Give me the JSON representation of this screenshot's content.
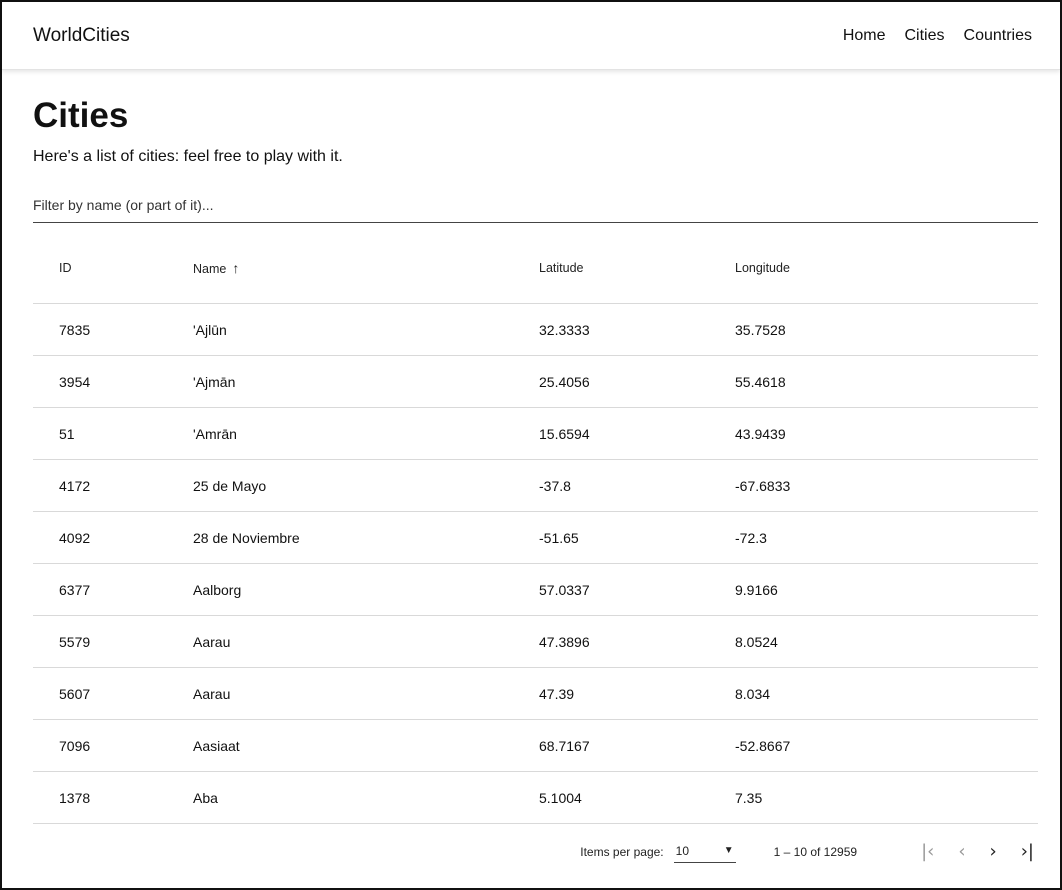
{
  "header": {
    "brand": "WorldCities",
    "nav": [
      "Home",
      "Cities",
      "Countries"
    ]
  },
  "page": {
    "title": "Cities",
    "subtitle": "Here's a list of cities: feel free to play with it."
  },
  "filter": {
    "placeholder": "Filter by name (or part of it)..."
  },
  "table": {
    "columns": {
      "id": "ID",
      "name": "Name",
      "lat": "Latitude",
      "lon": "Longitude"
    },
    "sort_icon": "arrow-up-icon",
    "rows": [
      {
        "id": "7835",
        "name": "'Ajlūn",
        "lat": "32.3333",
        "lon": "35.7528"
      },
      {
        "id": "3954",
        "name": "'Ajmān",
        "lat": "25.4056",
        "lon": "55.4618"
      },
      {
        "id": "51",
        "name": "'Amrān",
        "lat": "15.6594",
        "lon": "43.9439"
      },
      {
        "id": "4172",
        "name": "25 de Mayo",
        "lat": "-37.8",
        "lon": "-67.6833"
      },
      {
        "id": "4092",
        "name": "28 de Noviembre",
        "lat": "-51.65",
        "lon": "-72.3"
      },
      {
        "id": "6377",
        "name": "Aalborg",
        "lat": "57.0337",
        "lon": "9.9166"
      },
      {
        "id": "5579",
        "name": "Aarau",
        "lat": "47.3896",
        "lon": "8.0524"
      },
      {
        "id": "5607",
        "name": "Aarau",
        "lat": "47.39",
        "lon": "8.034"
      },
      {
        "id": "7096",
        "name": "Aasiaat",
        "lat": "68.7167",
        "lon": "-52.8667"
      },
      {
        "id": "1378",
        "name": "Aba",
        "lat": "5.1004",
        "lon": "7.35"
      }
    ]
  },
  "paginator": {
    "items_per_page_label": "Items per page:",
    "items_per_page": "10",
    "range": "1 – 10 of 12959",
    "first_icon": "first-page-icon",
    "prev_icon": "chevron-left-icon",
    "next_icon": "chevron-right-icon",
    "last_icon": "last-page-icon"
  }
}
